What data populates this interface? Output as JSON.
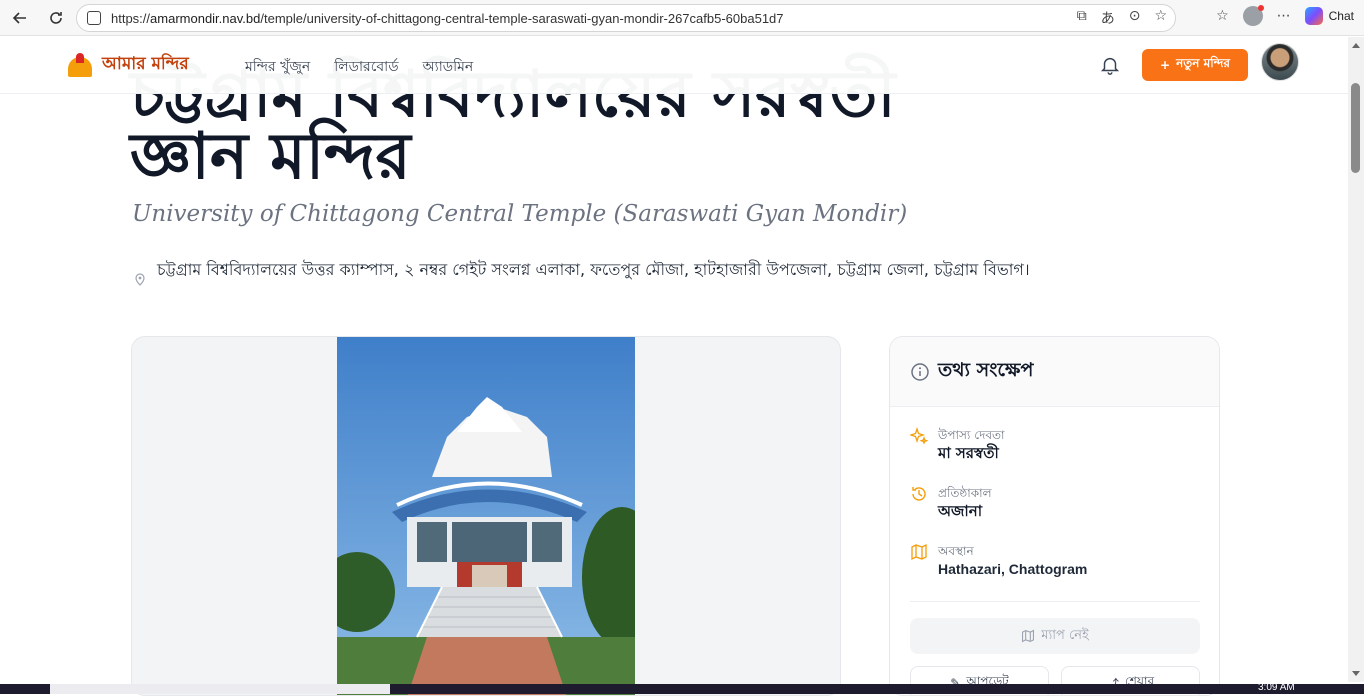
{
  "browser": {
    "url_host": "amarmondir.nav.bd",
    "url_path": "/temple/university-of-chittagong-central-temple-saraswati-gyan-mondir-267cafb5-60ba51d7",
    "url_prefix": "https://",
    "chat_label": "Chat"
  },
  "header": {
    "logo_text": "আমার মন্দির",
    "nav": [
      "মন্দির খুঁজুন",
      "লিডারবোর্ড",
      "অ্যাডমিন"
    ],
    "new_button": "নতুন মন্দির"
  },
  "temple": {
    "title_line1": "চট্টগ্রাম বিশ্ববিদ্যালয়ের সরস্বতী",
    "title_line2": "জ্ঞান মন্দির",
    "subtitle": "University of Chittagong Central Temple (Saraswati Gyan Mondir)",
    "address": "চট্টগ্রাম বিশ্ববিদ্যালয়ের উত্তর ক্যাম্পাস, ২ নম্বর গেইট সংলগ্ন এলাকা, ফতেপুর মৌজা, হাটহাজারী উপজেলা, চট্টগ্রাম জেলা, চট্টগ্রাম বিভাগ।"
  },
  "info": {
    "title": "তথ্য সংক্ষেপ",
    "facts": [
      {
        "label": "উপাস্য দেবতা",
        "value": "মা সরস্বতী",
        "icon": "sparkles-icon"
      },
      {
        "label": "প্রতিষ্ঠাকাল",
        "value": "অজানা",
        "icon": "history-icon"
      },
      {
        "label": "অবস্থান",
        "value": "Hathazari, Chattogram",
        "icon": "map-icon"
      }
    ],
    "map_button": "ম্যাপ নেই",
    "btn_left": "আপডেট",
    "btn_right": "শেয়ার"
  },
  "taskbar": {
    "clock": "3:09 AM"
  },
  "colors": {
    "accent": "#f97316",
    "text": "#111827",
    "muted": "#6b7280",
    "icon_orange": "#f59e0b"
  }
}
